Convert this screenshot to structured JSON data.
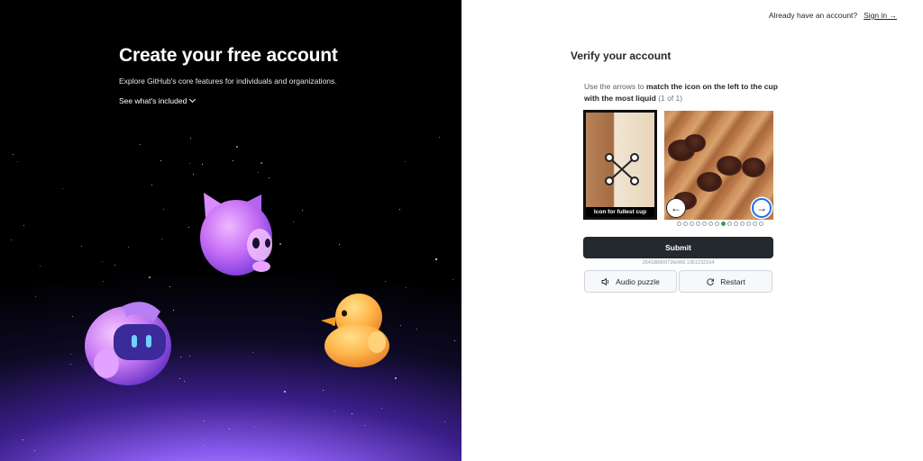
{
  "left": {
    "heading": "Create your free account",
    "subheading": "Explore GitHub's core features for individuals and organizations.",
    "see_included": "See what's included"
  },
  "topbar": {
    "prompt": "Already have an account?",
    "signin": "Sign in →"
  },
  "verify": {
    "title": "Verify your account",
    "instruction_pre": "Use the arrows to ",
    "instruction_bold": "match the icon on the left to the cup with the most liquid",
    "instruction_count": "(1 of 1)",
    "icon_label": "Icon for fullest cup",
    "arrow_left": "←",
    "arrow_right": "→",
    "page_count": 14,
    "active_page": 8,
    "submit": "Submit",
    "session_id": "25418890072fe066.1361232104",
    "audio": "Audio puzzle",
    "restart": "Restart"
  }
}
